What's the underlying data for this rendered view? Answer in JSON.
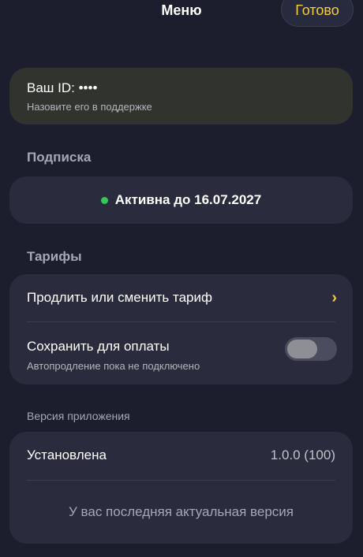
{
  "header": {
    "title": "Меню",
    "done_label": "Готово"
  },
  "account": {
    "id_label": "Ваш ID: ••••",
    "id_hint": "Назовите его в поддержке"
  },
  "subscription": {
    "section_title": "Подписка",
    "status_text": "Активна до 16.07.2027",
    "status_color": "#34c759"
  },
  "tariffs": {
    "section_title": "Тарифы",
    "change_label": "Продлить или сменить тариф",
    "save_payment_label": "Сохранить для оплаты",
    "save_payment_hint": "Автопродление пока не подключено",
    "save_payment_enabled": false
  },
  "version": {
    "section_title": "Версия приложения",
    "installed_label": "Установлена",
    "installed_value": "1.0.0 (100)",
    "status_note": "У вас последняя актуальная версия"
  },
  "colors": {
    "accent": "#f5cd3c",
    "background": "#1c1e2d",
    "card": "#2a2c3e"
  },
  "icons": {
    "chevron": "chevron-right-icon",
    "status": "status-dot-icon"
  }
}
